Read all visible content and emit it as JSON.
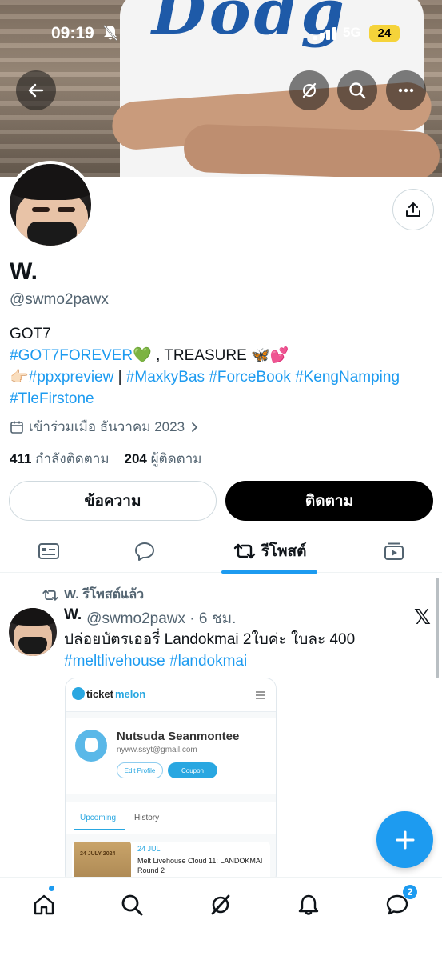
{
  "status": {
    "time": "09:19",
    "network": "5G",
    "battery": "24"
  },
  "profile": {
    "name": "W.",
    "handle": "@swmo2pawx",
    "bio_line1": "GOT7",
    "bio_tag1": "#GOT7FOREVER",
    "bio_emoji1": "💚",
    "bio_text2": " , TREASURE ",
    "bio_emoji2": "🦋💕",
    "bio_pointer": "👉🏻",
    "bio_tag2": "#ppxpreview",
    "bio_sep": " | ",
    "bio_tag3": "#MaxkyBas",
    "bio_tag4": "#ForceBook",
    "bio_tag5": "#KengNamping",
    "bio_tag6": "#TleFirstone",
    "joined": "เข้าร่วมเมือ ธันวาคม 2023",
    "following_count": "411",
    "following_label": "กำลังติดตาม",
    "followers_count": "204",
    "followers_label": "ผู้ติดตาม"
  },
  "actions": {
    "message": "ข้อความ",
    "follow": "ติดตาม"
  },
  "tabs": {
    "active_label": "รีโพสต์"
  },
  "post": {
    "repost_label": "W. รีโพสต์แล้ว",
    "name": "W.",
    "meta": "@swmo2pawx · 6 ชม.",
    "text": "ปล่อยบัตรเออรี่ Landokmai 2ใบค่ะ ใบละ 400",
    "tag1": "#meltlivehouse",
    "tag2": "#landokmai"
  },
  "card": {
    "logo_ticket": "ticket",
    "logo_melon": "melon",
    "user_name": "Nutsuda Seanmontee",
    "user_email": "nyww.ssyt@gmail.com",
    "edit_profile": "Edit Profile",
    "coupon": "Coupon",
    "tab_upcoming": "Upcoming",
    "tab_history": "History",
    "event_image_text": "24 JULY 2024",
    "event_date": "24 JUL",
    "event_title": "Melt Livehouse Cloud 11: LANDOKMAI Round 2"
  },
  "nav": {
    "messages_badge": "2"
  },
  "colors": {
    "accent": "#1d9bf0",
    "text": "#0f1419",
    "muted": "#536471"
  }
}
